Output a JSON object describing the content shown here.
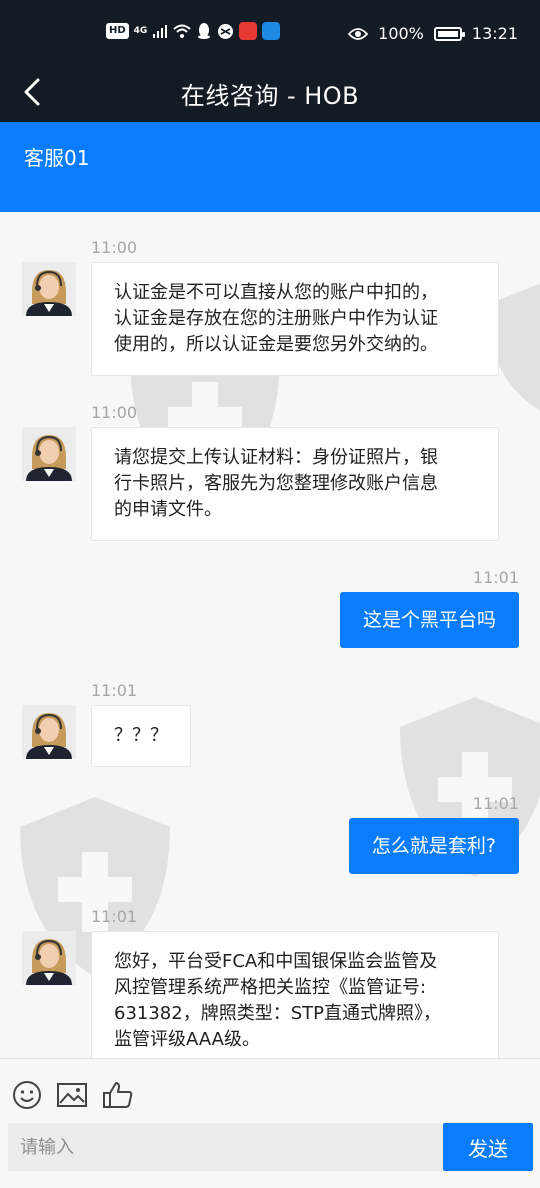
{
  "status_bar": {
    "hd": "HD",
    "network": "4G",
    "battery_percent": "100%",
    "time": "13:21"
  },
  "header": {
    "title": "在线咨询 - HOB",
    "back_icon": "chevron-left-icon"
  },
  "agent": {
    "name": "客服01"
  },
  "messages": [
    {
      "side": "left",
      "time": "11:00",
      "text_lines": [
        "认证金是不可以直接从您的账户中扣的，",
        "认证金是存放在您的注册账户中作为认证",
        "使用的，所以认证金是要您另外交纳的。"
      ]
    },
    {
      "side": "left",
      "time": "11:00",
      "text_lines": [
        "请您提交上传认证材料：身份证照片，银",
        "行卡照片，客服先为您整理修改账户信息",
        "的申请文件。"
      ]
    },
    {
      "side": "right",
      "time": "11:01",
      "text": "这是个黑平台吗"
    },
    {
      "side": "left",
      "time": "11:01",
      "text_lines": [
        "？？？"
      ]
    },
    {
      "side": "right",
      "time": "11:01",
      "text": "怎么就是套利?"
    },
    {
      "side": "left",
      "time": "11:01",
      "text_lines": [
        "您好，平台受FCA和中国银保监会监管及",
        "风控管理系统严格把关监控《监管证号:",
        "631382，牌照类型：STP直通式牌照》，",
        "监管评级AAA级。"
      ]
    }
  ],
  "composer": {
    "placeholder": "请输入",
    "send_label": "发送",
    "tools": [
      "emoji-icon",
      "image-icon",
      "thumbs-up-icon"
    ]
  },
  "colors": {
    "header_bg": "#131b25",
    "accent": "#0a7cff",
    "time_text": "#a6a6a6"
  }
}
